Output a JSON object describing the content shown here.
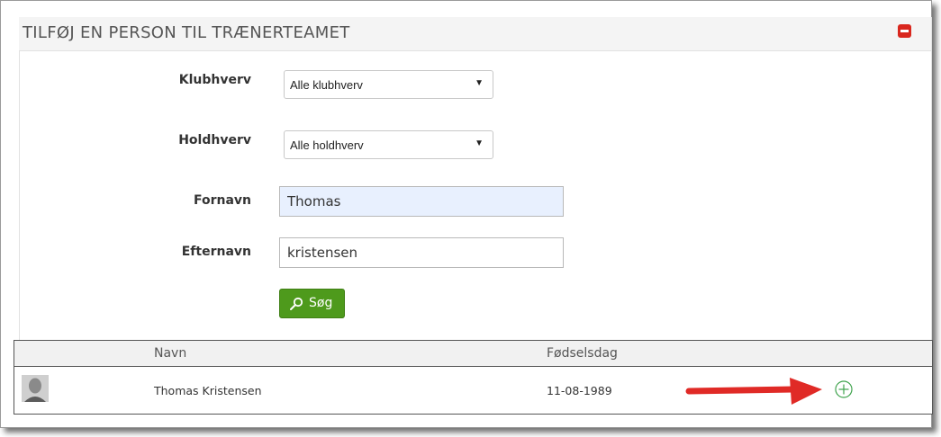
{
  "panel": {
    "title": "TILFØJ EN PERSON TIL TRÆNERTEAMET"
  },
  "form": {
    "klubhverv": {
      "label": "Klubhverv",
      "value": "Alle klubhverv"
    },
    "holdhverv": {
      "label": "Holdhverv",
      "value": "Alle holdhverv"
    },
    "fornavn": {
      "label": "Fornavn",
      "value": "Thomas"
    },
    "efternavn": {
      "label": "Efternavn",
      "value": "kristensen"
    },
    "search_label": "Søg"
  },
  "table": {
    "headers": [
      "",
      "Navn",
      "Fødselsdag",
      ""
    ],
    "rows": [
      {
        "name": "Thomas Kristensen",
        "birthday": "11-08-1989"
      }
    ]
  },
  "colors": {
    "accent_green": "#4e9a1c",
    "collapse_red": "#d9271e",
    "add_green": "#3fa34d",
    "arrow_red": "#e02a26"
  }
}
